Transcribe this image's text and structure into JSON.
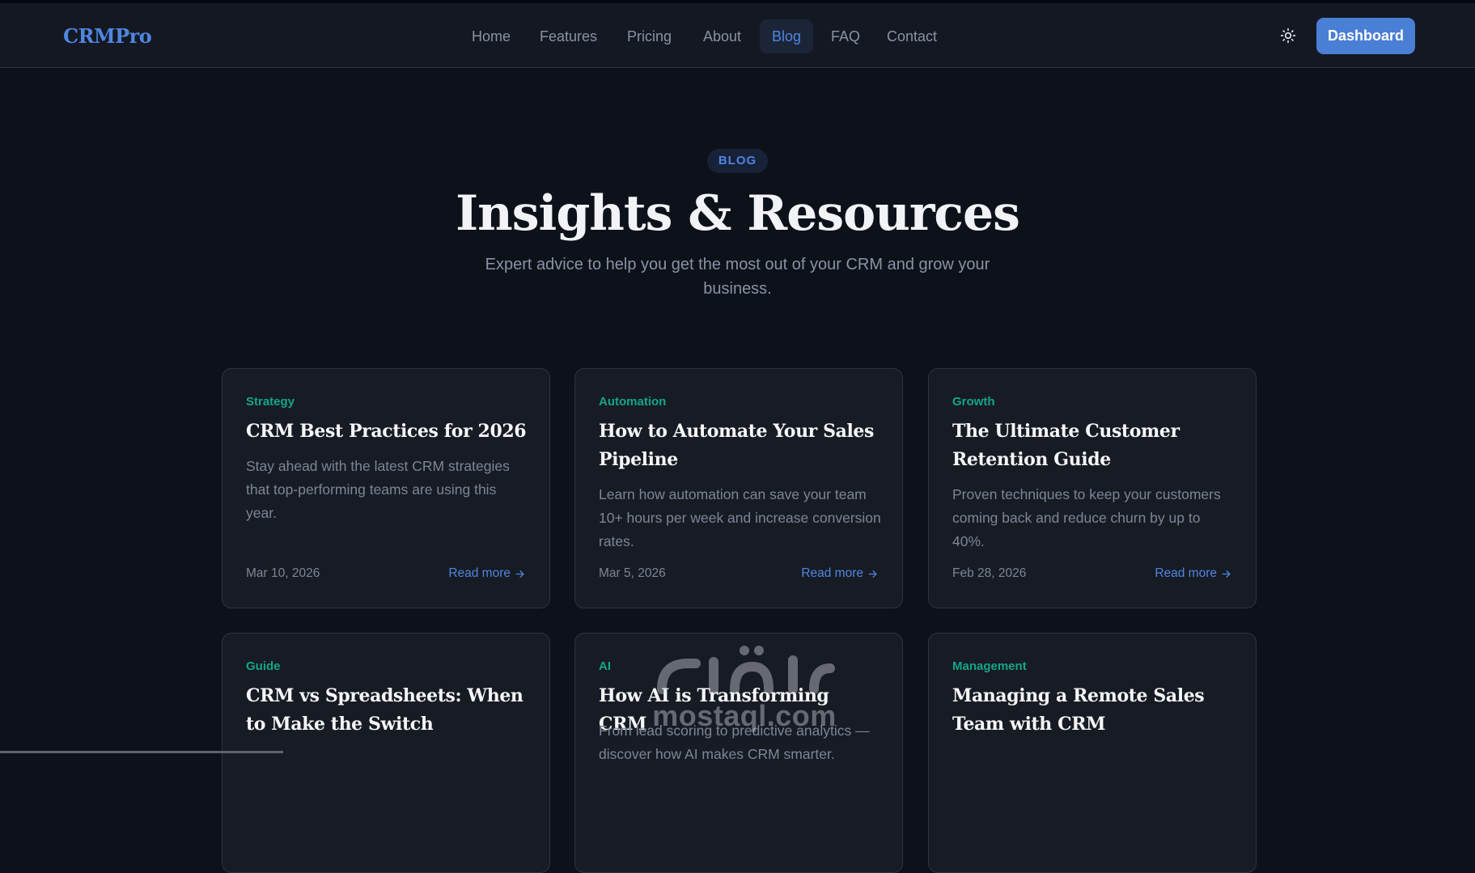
{
  "brand": {
    "logo": "CRMPro"
  },
  "nav": {
    "items": [
      {
        "label": "Home"
      },
      {
        "label": "Features"
      },
      {
        "label": "Pricing"
      },
      {
        "label": "About"
      },
      {
        "label": "Blog",
        "active": true
      },
      {
        "label": "FAQ"
      },
      {
        "label": "Contact"
      }
    ],
    "theme_icon": "sun-icon",
    "dashboard_label": "Dashboard"
  },
  "hero": {
    "badge": "BLOG",
    "title": "Insights & Resources",
    "subtitle": "Expert advice to help you get the most out of your CRM and grow your business."
  },
  "posts": [
    {
      "category": "Strategy",
      "title": "CRM Best Practices for 2026",
      "excerpt": "Stay ahead with the latest CRM strategies that top-performing teams are using this year.",
      "date": "Mar 10, 2026",
      "link": "Read more"
    },
    {
      "category": "Automation",
      "title": "How to Automate Your Sales Pipeline",
      "excerpt": "Learn how automation can save your team 10+ hours per week and increase conversion rates.",
      "date": "Mar 5, 2026",
      "link": "Read more"
    },
    {
      "category": "Growth",
      "title": "The Ultimate Customer Retention Guide",
      "excerpt": "Proven techniques to keep your customers coming back and reduce churn by up to 40%.",
      "date": "Feb 28, 2026",
      "link": "Read more"
    },
    {
      "category": "Guide",
      "title": "CRM vs Spreadsheets: When to Make the Switch",
      "excerpt": "",
      "date": "",
      "link": ""
    },
    {
      "category": "AI",
      "title": "How AI is Transforming CRM",
      "excerpt": "From lead scoring to predictive analytics — discover how AI makes CRM smarter.",
      "date": "",
      "link": ""
    },
    {
      "category": "Management",
      "title": "Managing a Remote Sales Team with CRM",
      "excerpt": "",
      "date": "",
      "link": ""
    }
  ],
  "watermark": {
    "text": "mostaql.com",
    "arabic": "مستقل"
  },
  "colors": {
    "background": "#0d111a",
    "navbar": "#131822",
    "card": "#171b24",
    "accent": "#4a7fd6",
    "category": "#13a589"
  }
}
